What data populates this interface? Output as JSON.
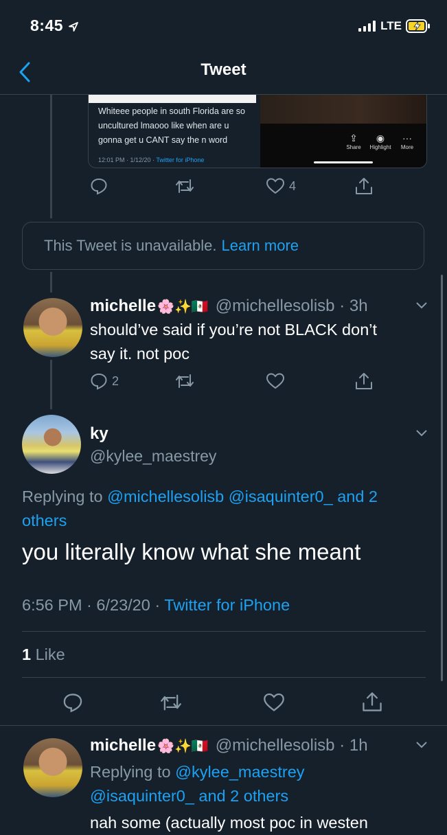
{
  "status": {
    "time": "8:45",
    "network": "LTE"
  },
  "header": {
    "title": "Tweet"
  },
  "quoted_card": {
    "text": "Whiteee people in south Florida are so uncultured lmaooo like when are u gonna get u CANT say the n word",
    "meta": "12:01 PM · 1/12/20 · ",
    "meta_source": "Twitter for iPhone",
    "actions": [
      {
        "label": "Share",
        "icon": "share-icon"
      },
      {
        "label": "Highlight",
        "icon": "highlight-icon"
      },
      {
        "label": "More",
        "icon": "more-icon"
      }
    ]
  },
  "tweet1_actions": {
    "reply_count": "",
    "retweet_count": "",
    "like_count": "4"
  },
  "unavailable": {
    "text": "This Tweet is unavailable.",
    "link": "Learn more"
  },
  "reply1": {
    "name": "michelle",
    "emojis": "🌸✨🇲🇽",
    "handle": "@michellesolisb",
    "time": "3h",
    "text_line1": "should’ve said if you’re not BLACK don’t",
    "text_line2": "say it. not poc",
    "reply_count": "2"
  },
  "main": {
    "name": "ky",
    "handle": "@kylee_maestrey",
    "replying_prefix": "Replying to",
    "replying_users": "@michellesolisb @isaquinter0_ and 2",
    "replying_cont": "others",
    "text": "you literally know what she meant",
    "time": "6:56 PM · 6/23/20 · ",
    "source": "Twitter for iPhone",
    "likes_count": "1",
    "likes_label": "Like"
  },
  "reply2": {
    "name": "michelle",
    "emojis": "🌸✨🇲🇽",
    "handle": "@michellesolisb",
    "time": "1h",
    "replying_prefix": "Replying to",
    "replying_line1": "@kylee_maestrey",
    "replying_line2": "@isaquinter0_ and 2 others",
    "text_partial": "nah some (actually most poc in westen"
  },
  "colors": {
    "background": "#15202b",
    "accent": "#1da1f2",
    "muted": "#8899a6",
    "divider": "#38444d"
  }
}
